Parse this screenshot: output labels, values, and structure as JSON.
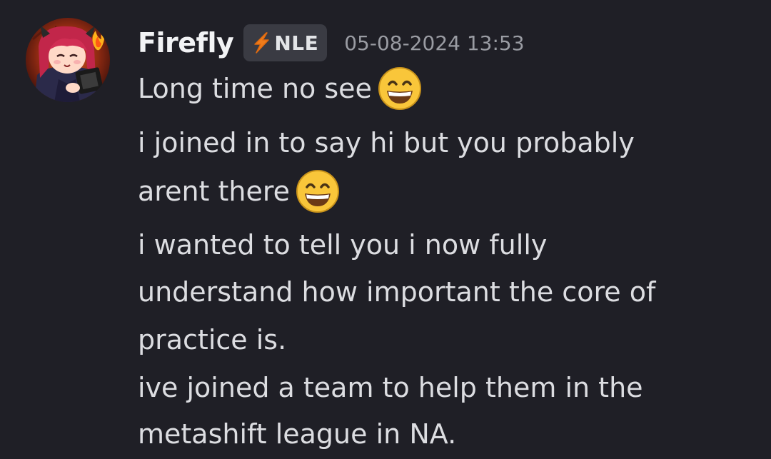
{
  "message": {
    "username": "Firefly",
    "tag": {
      "label": "NLE",
      "icon": "lightning-bolt-icon",
      "color": "#f07c1b"
    },
    "timestamp": "05-08-2024 13:53",
    "lines": [
      {
        "text": "Long time no see",
        "emoji": "grinning-face-emoji"
      },
      {
        "text": "i joined in to say hi but you probably"
      },
      {
        "text": "arent there",
        "emoji": "grinning-face-emoji"
      },
      {
        "text": "i wanted to tell you i now fully"
      },
      {
        "text": "understand how important the core of"
      },
      {
        "text": "practice is."
      },
      {
        "text": "ive joined a team to help them in the"
      },
      {
        "text": "metashift league in NA."
      }
    ]
  },
  "colors": {
    "background": "#1f1f26",
    "username": "#f2f3f5",
    "text": "#dcdde1",
    "timestamp": "#9a9ca3",
    "tag_background": "#3a3b43"
  }
}
